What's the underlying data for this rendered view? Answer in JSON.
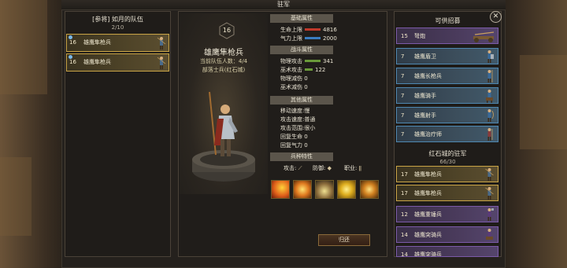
{
  "window_title": "驻军",
  "party": {
    "title": "[参将] 如月的队伍",
    "count": "2/10",
    "units": [
      {
        "level": "16",
        "name": "雄鹰隼枪兵"
      },
      {
        "level": "16",
        "name": "雄鹰隼枪兵"
      }
    ]
  },
  "unit_detail": {
    "level": "16",
    "name": "雄鹰隼枪兵",
    "party_count": "当前队伍人数：4/4",
    "faction": "部落士兵(红石城)",
    "sections": {
      "basic": "基础属性",
      "combat": "战斗属性",
      "other": "其他属性",
      "traits": "兵种特性"
    },
    "basic_stats": [
      {
        "label": "生命上限",
        "value": "4816",
        "color": "#c0392b"
      },
      {
        "label": "气力上限",
        "value": "2000",
        "color": "#3a7cc0"
      }
    ],
    "combat_stats": [
      {
        "label": "物理攻击",
        "value": "341",
        "color": "#6a9a3a"
      },
      {
        "label": "巫术攻击",
        "value": "122",
        "color": "#6a9a3a"
      },
      {
        "label": "物理减伤",
        "value": "0"
      },
      {
        "label": "巫术减伤",
        "value": "0"
      }
    ],
    "other_stats": [
      {
        "label": "移动速度",
        "value": "慢"
      },
      {
        "label": "攻击速度",
        "value": "普通"
      },
      {
        "label": "攻击范围",
        "value": "很小"
      },
      {
        "label": "回复生命",
        "value": "0"
      },
      {
        "label": "回复气力",
        "value": "0"
      }
    ],
    "trait_labels": {
      "attack": "攻击:",
      "defense": "防御:",
      "class": "职业:"
    },
    "skills": [
      "fire-slash-icon",
      "whirlwind-icon",
      "claw-strike-icon",
      "golden-orb-icon",
      "burst-icon"
    ]
  },
  "return_button": "归还",
  "recruitable": {
    "title": "可供招募",
    "units": [
      {
        "level": "15",
        "name": "弩炮",
        "tier": "purple"
      },
      {
        "level": "7",
        "name": "雄鹰盾卫",
        "tier": "blue"
      },
      {
        "level": "7",
        "name": "雄鹰长枪兵",
        "tier": "blue"
      },
      {
        "level": "7",
        "name": "雄鹰骑手",
        "tier": "blue"
      },
      {
        "level": "7",
        "name": "雄鹰射手",
        "tier": "blue"
      },
      {
        "level": "7",
        "name": "雄鹰治疗师",
        "tier": "blue"
      }
    ]
  },
  "garrison": {
    "title": "红石城的驻军",
    "count": "66/30",
    "units": [
      {
        "level": "17",
        "name": "雄鹰隼枪兵",
        "tier": "gold"
      },
      {
        "level": "17",
        "name": "雄鹰隼枪兵",
        "tier": "gold"
      },
      {
        "level": "12",
        "name": "雄鹰重锤兵",
        "tier": "purple"
      },
      {
        "level": "14",
        "name": "雄鹰突骑兵",
        "tier": "purple"
      },
      {
        "level": "14",
        "name": "雄鹰突骑兵",
        "tier": "purple"
      }
    ]
  },
  "close_icon": "close-icon"
}
